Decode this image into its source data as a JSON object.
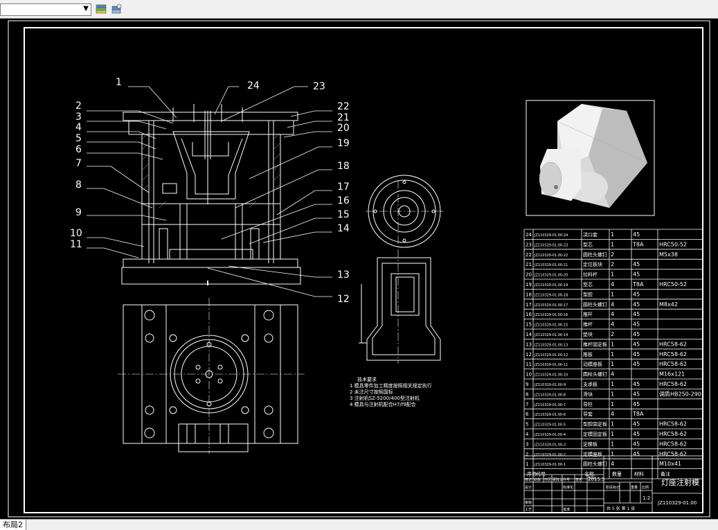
{
  "statusbar": {
    "tab_label": "布局2"
  },
  "callouts_left": [
    "1",
    "2",
    "3",
    "4",
    "5",
    "6",
    "7",
    "8",
    "9",
    "10",
    "11"
  ],
  "callouts_right": [
    "24",
    "23",
    "22",
    "21",
    "20",
    "19",
    "18",
    "17",
    "16",
    "15",
    "14",
    "13",
    "12"
  ],
  "notes": [
    "技术要求",
    "1  模具零件加工精度按照相关规定执行",
    "2  未注尺寸按照国标",
    "3  注射机SZ-5200/400型注射机",
    "4  模具与注射机配合H7/f9配合"
  ],
  "bom": [
    {
      "no": "24",
      "code": "JZ110329-01.00-24",
      "name": "浇口套",
      "qty": "1",
      "mat": "45",
      "note": ""
    },
    {
      "no": "23",
      "code": "JZ110329-01.00-23",
      "name": "型芯",
      "qty": "1",
      "mat": "T8A",
      "note": "HRC50-52"
    },
    {
      "no": "22",
      "code": "JZ110329-01.00-22",
      "name": "圆柱头螺钉",
      "qty": "2",
      "mat": "",
      "note": "M5x38"
    },
    {
      "no": "21",
      "code": "JZ110329-01.00-21",
      "name": "定位板块",
      "qty": "2",
      "mat": "45",
      "note": ""
    },
    {
      "no": "20",
      "code": "JZ110329-01.00-20",
      "name": "拉料杆",
      "qty": "1",
      "mat": "45",
      "note": ""
    },
    {
      "no": "19",
      "code": "JZ110329-01.00-19",
      "name": "型芯",
      "qty": "4",
      "mat": "T8A",
      "note": "HRC50-52"
    },
    {
      "no": "18",
      "code": "JZ110329-01.00-18",
      "name": "型腔",
      "qty": "1",
      "mat": "45",
      "note": ""
    },
    {
      "no": "17",
      "code": "JZ110329-01.00-17",
      "name": "圆柱头螺钉",
      "qty": "4",
      "mat": "45",
      "note": "M8x42"
    },
    {
      "no": "16",
      "code": "JZ110329-01.00-16",
      "name": "推杆",
      "qty": "4",
      "mat": "45",
      "note": ""
    },
    {
      "no": "15",
      "code": "JZ110329-01.00-15",
      "name": "推杆",
      "qty": "4",
      "mat": "45",
      "note": ""
    },
    {
      "no": "14",
      "code": "JZ110329-01.00-14",
      "name": "垫块",
      "qty": "2",
      "mat": "45",
      "note": ""
    },
    {
      "no": "13",
      "code": "JZ110329-01.00-13",
      "name": "推杆固定板",
      "qty": "1",
      "mat": "45",
      "note": "HRC58-62"
    },
    {
      "no": "12",
      "code": "JZ110329-01.00-12",
      "name": "推板",
      "qty": "1",
      "mat": "45",
      "note": "HRC58-62"
    },
    {
      "no": "11",
      "code": "JZ110329-01.00-11",
      "name": "动模座板",
      "qty": "1",
      "mat": "45",
      "note": "HRC58-62"
    },
    {
      "no": "10",
      "code": "JZ110329-01.00-10",
      "name": "圆柱头螺钉",
      "qty": "4",
      "mat": "",
      "note": "M16x121"
    },
    {
      "no": "9",
      "code": "JZ110329-01.00-9",
      "name": "支承板",
      "qty": "1",
      "mat": "45",
      "note": "HRC58-62"
    },
    {
      "no": "8",
      "code": "JZ110329-01.00-8",
      "name": "滑块",
      "qty": "1",
      "mat": "45",
      "note": "调质HB250-290"
    },
    {
      "no": "7",
      "code": "JZ110329-01.00-7",
      "name": "导柱",
      "qty": "1",
      "mat": "45",
      "note": ""
    },
    {
      "no": "6",
      "code": "JZ110329-01.00-6",
      "name": "导套",
      "qty": "4",
      "mat": "T8A",
      "note": ""
    },
    {
      "no": "5",
      "code": "JZ110329-01.00-5",
      "name": "型腔固定板",
      "qty": "1",
      "mat": "45",
      "note": "HRC58-62"
    },
    {
      "no": "4",
      "code": "JZ110329-01.00-4",
      "name": "定模固定板",
      "qty": "1",
      "mat": "45",
      "note": "HRC58-62"
    },
    {
      "no": "3",
      "code": "JZ110329-01.00-3",
      "name": "定模板",
      "qty": "1",
      "mat": "45",
      "note": "HRC58-62"
    },
    {
      "no": "2",
      "code": "JZ110329-01.00-2",
      "name": "定模座板",
      "qty": "1",
      "mat": "45",
      "note": "HRC58-62"
    },
    {
      "no": "1",
      "code": "JZ110329-01.00-1",
      "name": "圆柱头螺钉",
      "qty": "4",
      "mat": "",
      "note": "M10x41"
    }
  ],
  "bom_header": {
    "no": "序号",
    "code": "代号",
    "name": "名称",
    "qty": "数量",
    "mat": "材料",
    "note": "备注"
  },
  "titleblock": {
    "title": "灯座注射模",
    "drawing_no": "JZ110329-01.00",
    "scale": "1:2",
    "sheets": "共 5 张  第 1 张",
    "date": "2015.5",
    "r1": [
      "标记",
      "处数",
      "分区",
      "更改文件号",
      "签名",
      "年月日"
    ],
    "r2": [
      "设计",
      "标准化"
    ],
    "stage_labels": [
      "阶段标记",
      "重量",
      "比例"
    ],
    "r3": [
      "审核"
    ],
    "r4": [
      "工艺",
      "批准"
    ]
  }
}
